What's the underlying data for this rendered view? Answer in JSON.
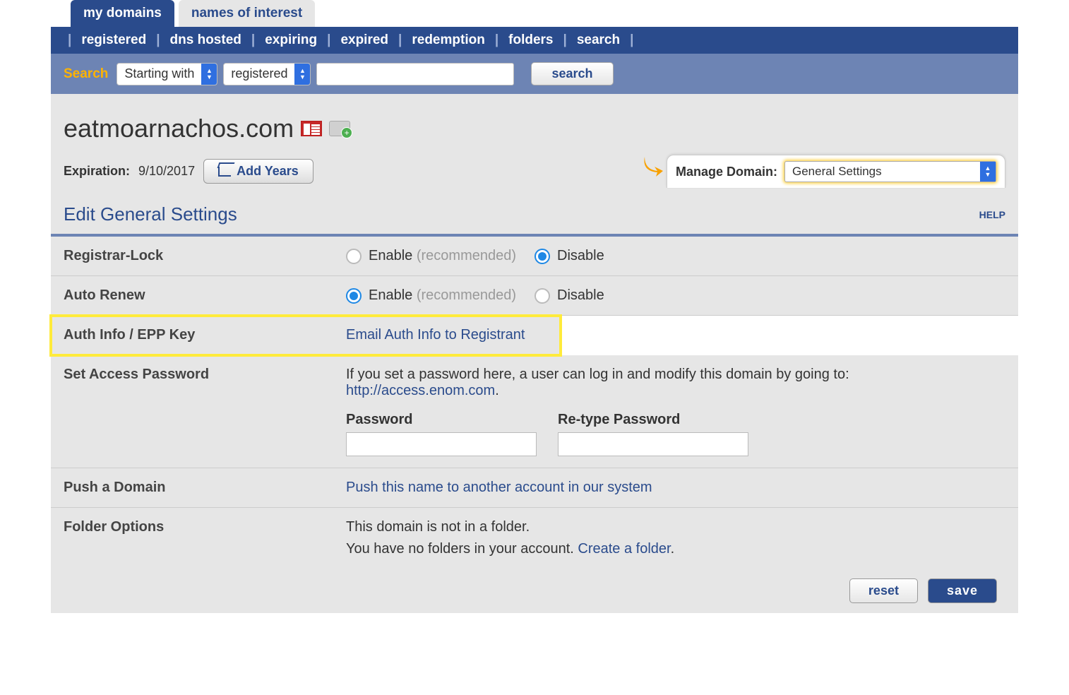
{
  "tabs": {
    "active": "my domains",
    "inactive": "names of interest"
  },
  "subnav": [
    "registered",
    "dns hosted",
    "expiring",
    "expired",
    "redemption",
    "folders",
    "search"
  ],
  "search": {
    "label": "Search",
    "mode": "Starting with",
    "scope": "registered",
    "button": "search"
  },
  "domain": {
    "name": "eatmoarnachos.com",
    "expiration_label": "Expiration:",
    "expiration_date": "9/10/2017",
    "add_years": "Add Years",
    "manage_label": "Manage Domain:",
    "manage_select": "General Settings"
  },
  "header": {
    "title": "Edit General Settings",
    "help": "HELP"
  },
  "rows": {
    "registrar_lock": {
      "label": "Registrar-Lock",
      "enable": "Enable",
      "recommended": "(recommended)",
      "disable": "Disable",
      "value": "disable"
    },
    "auto_renew": {
      "label": "Auto Renew",
      "enable": "Enable",
      "recommended": "(recommended)",
      "disable": "Disable",
      "value": "enable"
    },
    "auth_info": {
      "label": "Auth Info / EPP Key",
      "link": "Email Auth Info to Registrant"
    },
    "access_pw": {
      "label": "Set Access Password",
      "desc_pre": "If you set a password here, a user can log in and modify this domain by going to: ",
      "desc_link": "http://access.enom.com",
      "desc_post": ".",
      "password_label": "Password",
      "retype_label": "Re-type Password"
    },
    "push": {
      "label": "Push a Domain",
      "link": "Push this name to another account in our system"
    },
    "folder": {
      "label": "Folder Options",
      "line1": "This domain is not in a folder.",
      "line2_pre": " You have no folders in your account. ",
      "line2_link": "Create a folder",
      "line2_post": "."
    }
  },
  "footer": {
    "reset": "reset",
    "save": "save"
  }
}
